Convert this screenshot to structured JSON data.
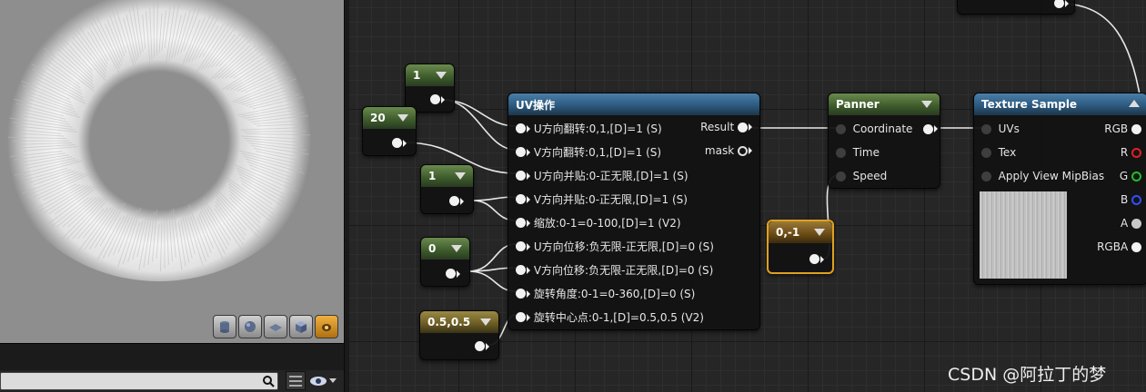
{
  "preview": {
    "mode_buttons": [
      "cylinder-icon",
      "sphere-icon",
      "plane-icon",
      "cube-icon",
      "teapot-icon"
    ],
    "active_mode": "teapot-icon"
  },
  "palette": {
    "search_value": "",
    "view_options_icon": "list-icon",
    "visibility_icon": "eye-icon"
  },
  "nodes": {
    "const1": {
      "value": "1"
    },
    "const20": {
      "value": "20"
    },
    "const1b": {
      "value": "1"
    },
    "const0": {
      "value": "0"
    },
    "const05": {
      "value": "0.5,0.5"
    },
    "const01": {
      "value": "0,-1"
    },
    "uv": {
      "title": "UV操作",
      "inputs": [
        "U方向翻转:0,1,[D]=1 (S)",
        "V方向翻转:0,1,[D]=1 (S)",
        "U方向并贴:0-正无限,[D]=1 (S)",
        "V方向并贴:0-正无限,[D]=1 (S)",
        "缩放:0-1=0-100,[D]=1 (V2)",
        "U方向位移:负无限-正无限,[D]=0 (S)",
        "V方向位移:负无限-正无限,[D]=0 (S)",
        "旋转角度:0-1=0-360,[D]=0 (S)",
        "旋转中心点:0-1,[D]=0.5,0.5 (V2)"
      ],
      "outputs": [
        "Result",
        "mask"
      ]
    },
    "panner": {
      "title": "Panner",
      "inputs": [
        "Coordinate",
        "Time",
        "Speed"
      ]
    },
    "texture": {
      "title": "Texture Sample",
      "inputs": [
        "UVs",
        "Tex",
        "Apply View MipBias"
      ],
      "outputs": [
        "RGB",
        "R",
        "G",
        "B",
        "A",
        "RGBA"
      ]
    }
  },
  "colors": {
    "r": "#e02020",
    "g": "#20c020",
    "b": "#3050ff",
    "selection": "#e0a020"
  },
  "watermark": "CSDN @阿拉丁的梦"
}
